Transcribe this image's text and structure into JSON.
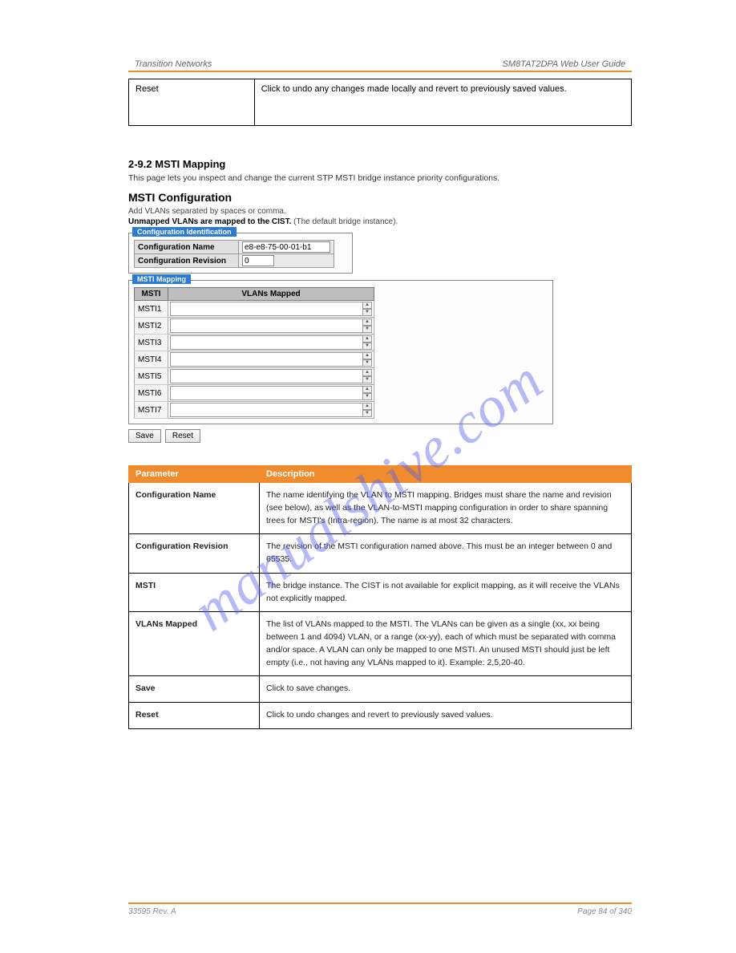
{
  "header": {
    "left": "Transition Networks",
    "right": "SM8TAT2DPA Web User Guide"
  },
  "topTable": {
    "left": "Reset",
    "right": "Click to undo any changes made locally and revert to previously saved values."
  },
  "sectionTitle": "2-9.2 MSTI Mapping",
  "sectionText": "This page lets you inspect and change the current STP MSTI bridge instance priority configurations.",
  "screenshot": {
    "title": "MSTI Configuration",
    "sub1": "Add VLANs separated by spaces or comma.",
    "sub2a": "Unmapped VLANs are mapped to the CIST.",
    "sub2b": " (The default bridge instance).",
    "ident": {
      "legend": "Configuration Identification",
      "rows": [
        {
          "label": "Configuration Name",
          "value": "e8-e8-75-00-01-b1"
        },
        {
          "label": "Configuration Revision",
          "value": "0"
        }
      ]
    },
    "mapping": {
      "legend": "MSTI Mapping",
      "headers": [
        "MSTI",
        "VLANs Mapped"
      ],
      "rows": [
        "MSTI1",
        "MSTI2",
        "MSTI3",
        "MSTI4",
        "MSTI5",
        "MSTI6",
        "MSTI7"
      ]
    },
    "saveLabel": "Save",
    "resetLabel": "Reset"
  },
  "descTable": {
    "headers": [
      "Parameter",
      "Description"
    ],
    "rows": [
      {
        "p": "Configuration Name",
        "d": "The name identifying the VLAN to MSTI mapping. Bridges must share the name and revision (see below), as well as the VLAN-to-MSTI mapping configuration in order to share spanning trees for MSTI's (Intra-region). The name is at most 32 characters."
      },
      {
        "p": "Configuration Revision",
        "d": "The revision of the MSTI configuration named above. This must be an integer between 0 and 65535."
      },
      {
        "p": "MSTI",
        "d": "The bridge instance. The CIST is not available for explicit mapping, as it will receive the VLANs not explicitly mapped."
      },
      {
        "p": "VLANs Mapped",
        "d": "The list of VLANs mapped to the MSTI. The VLANs can be given as a single (xx, xx being between 1 and 4094) VLAN, or a range (xx-yy), each of which must be separated with comma and/or space. A VLAN can only be mapped to one MSTI. An unused MSTI should just be left empty (i.e., not having any VLANs mapped to it). Example: 2,5,20-40."
      },
      {
        "p": "Save",
        "d": "Click to save changes."
      },
      {
        "p": "Reset",
        "d": "Click to undo changes and revert to previously saved values."
      }
    ]
  },
  "footer": {
    "left": "33595 Rev. A",
    "right": "Page 84 of 340"
  },
  "watermark": "manualshive.com"
}
